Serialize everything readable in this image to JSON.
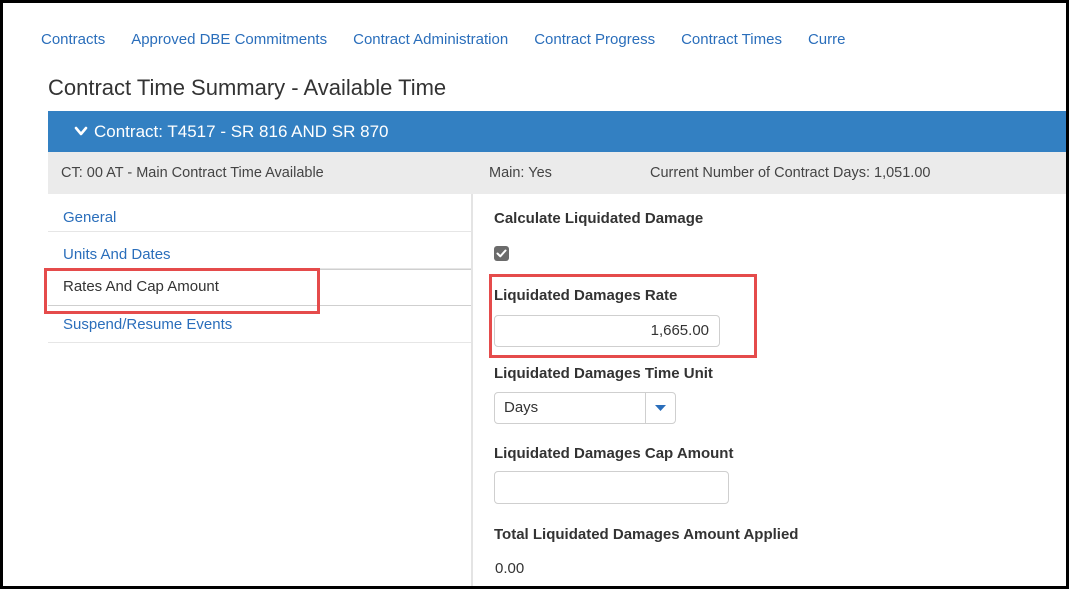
{
  "top_tabs": [
    {
      "label": "Contracts"
    },
    {
      "label": "Approved DBE Commitments"
    },
    {
      "label": "Contract Administration"
    },
    {
      "label": "Contract Progress"
    },
    {
      "label": "Contract Times"
    },
    {
      "label": "Curre"
    }
  ],
  "page_title": "Contract Time Summary - Available Time",
  "contract_bar": {
    "icon": "chevron-down-icon",
    "label": "Contract: T4517 - SR 816 AND SR 870",
    "color": "#3380c2"
  },
  "info_row": {
    "contract_time": "CT: 00 AT - Main Contract Time Available",
    "main": "Main: Yes",
    "days": "Current Number of Contract Days: 1,051.00"
  },
  "sidebar": {
    "items": [
      {
        "label": "General"
      },
      {
        "label": "Units And Dates"
      },
      {
        "label": "Rates And Cap Amount",
        "active": true
      },
      {
        "label": "Suspend/Resume Events"
      }
    ]
  },
  "form": {
    "calculate_ld_label": "Calculate Liquidated Damage",
    "calculate_ld_checked": true,
    "ld_rate_label": "Liquidated Damages Rate",
    "ld_rate_value": "1,665.00",
    "ld_time_unit_label": "Liquidated Damages Time Unit",
    "ld_time_unit_value": "Days",
    "ld_cap_label": "Liquidated Damages Cap Amount",
    "ld_cap_value": "",
    "total_ld_label": "Total Liquidated Damages Amount Applied",
    "total_ld_value": "0.00"
  },
  "colors": {
    "link": "#2a6ebb",
    "highlight": "#e54b4b"
  }
}
